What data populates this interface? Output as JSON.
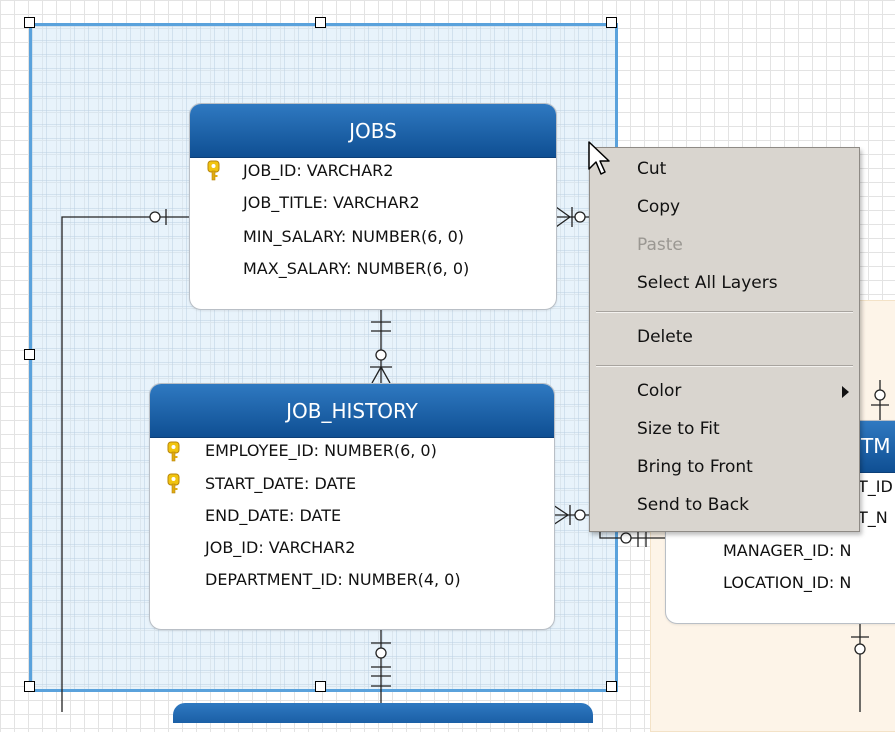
{
  "diagram": {
    "entities": {
      "jobs": {
        "name": "JOBS",
        "attributes": [
          {
            "label": "JOB_ID: VARCHAR2",
            "primary_key": true
          },
          {
            "label": "JOB_TITLE: VARCHAR2",
            "primary_key": false
          },
          {
            "label": "MIN_SALARY: NUMBER(6, 0)",
            "primary_key": false
          },
          {
            "label": "MAX_SALARY: NUMBER(6, 0)",
            "primary_key": false
          }
        ]
      },
      "job_history": {
        "name": "JOB_HISTORY",
        "attributes": [
          {
            "label": "EMPLOYEE_ID: NUMBER(6, 0)",
            "primary_key": true
          },
          {
            "label": "START_DATE: DATE",
            "primary_key": true
          },
          {
            "label": "END_DATE: DATE",
            "primary_key": false
          },
          {
            "label": "JOB_ID: VARCHAR2",
            "primary_key": false
          },
          {
            "label": "DEPARTMENT_ID: NUMBER(4, 0)",
            "primary_key": false
          }
        ]
      },
      "departments_partial": {
        "name_visible": "TM",
        "attributes_visible": [
          "T_ID",
          "T_N",
          "MANAGER_ID: N",
          "LOCATION_ID: N"
        ]
      }
    },
    "colors": {
      "entity_header": "#1b5fa6",
      "selection_border": "#5aa2dc",
      "selection_fill": "#d6eaf8",
      "peach_layer": "#fdf4e8",
      "menu_background": "#d9d5cf"
    }
  },
  "context_menu": {
    "items": [
      {
        "label": "Cut",
        "enabled": true
      },
      {
        "label": "Copy",
        "enabled": true
      },
      {
        "label": "Paste",
        "enabled": false
      },
      {
        "label": "Select All Layers",
        "enabled": true
      },
      {
        "label": "Delete",
        "enabled": true
      },
      {
        "label": "Color",
        "enabled": true,
        "submenu": true
      },
      {
        "label": "Size to Fit",
        "enabled": true
      },
      {
        "label": "Bring to Front",
        "enabled": true
      },
      {
        "label": "Send to Back",
        "enabled": true
      }
    ]
  },
  "icons": {
    "primary_key": "key-icon",
    "cursor": "mouse-pointer-icon",
    "submenu": "chevron-right-icon"
  }
}
